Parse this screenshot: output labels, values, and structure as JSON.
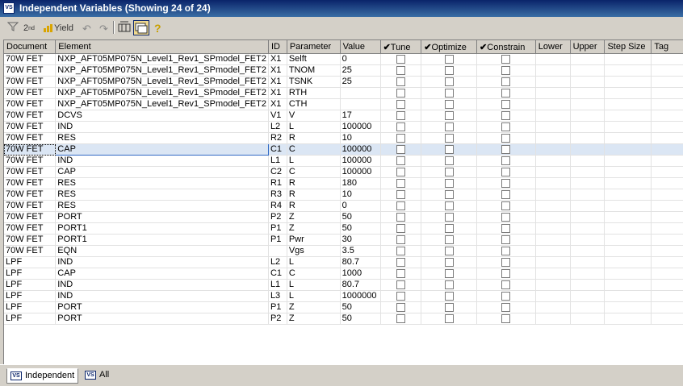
{
  "window": {
    "title": "Independent Variables (Showing 24 of 24)",
    "icon": "vs-icon"
  },
  "toolbar": {
    "filter_icon": "filter-icon",
    "sort_label": "2",
    "yield_label": "Yield",
    "undo_icon": "undo-icon",
    "redo_icon": "redo-icon",
    "columns_icon": "columns-icon",
    "view_icon": "view-icon",
    "help_icon": "help-icon"
  },
  "grid": {
    "columns": [
      "Document",
      "Element",
      "ID",
      "Parameter",
      "Value",
      "Tune",
      "Optimize",
      "Constrain",
      "Lower",
      "Upper",
      "Step Size",
      "Tag"
    ],
    "rows": [
      {
        "document": "70W FET",
        "element": "NXP_AFT05MP075N_Level1_Rev1_SPmodel_FET2",
        "id": "X1",
        "parameter": "Selft",
        "value": "0"
      },
      {
        "document": "70W FET",
        "element": "NXP_AFT05MP075N_Level1_Rev1_SPmodel_FET2",
        "id": "X1",
        "parameter": "TNOM",
        "value": "25"
      },
      {
        "document": "70W FET",
        "element": "NXP_AFT05MP075N_Level1_Rev1_SPmodel_FET2",
        "id": "X1",
        "parameter": "TSNK",
        "value": "25"
      },
      {
        "document": "70W FET",
        "element": "NXP_AFT05MP075N_Level1_Rev1_SPmodel_FET2",
        "id": "X1",
        "parameter": "RTH",
        "value": ""
      },
      {
        "document": "70W FET",
        "element": "NXP_AFT05MP075N_Level1_Rev1_SPmodel_FET2",
        "id": "X1",
        "parameter": "CTH",
        "value": ""
      },
      {
        "document": "70W FET",
        "element": "DCVS",
        "id": "V1",
        "parameter": "V",
        "value": "17"
      },
      {
        "document": "70W FET",
        "element": "IND",
        "id": "L2",
        "parameter": "L",
        "value": "100000"
      },
      {
        "document": "70W FET",
        "element": "RES",
        "id": "R2",
        "parameter": "R",
        "value": "10"
      },
      {
        "document": "70W FET",
        "element": "CAP",
        "id": "C1",
        "parameter": "C",
        "value": "100000"
      },
      {
        "document": "70W FET",
        "element": "IND",
        "id": "L1",
        "parameter": "L",
        "value": "100000"
      },
      {
        "document": "70W FET",
        "element": "CAP",
        "id": "C2",
        "parameter": "C",
        "value": "100000"
      },
      {
        "document": "70W FET",
        "element": "RES",
        "id": "R1",
        "parameter": "R",
        "value": "180"
      },
      {
        "document": "70W FET",
        "element": "RES",
        "id": "R3",
        "parameter": "R",
        "value": "10"
      },
      {
        "document": "70W FET",
        "element": "RES",
        "id": "R4",
        "parameter": "R",
        "value": "0"
      },
      {
        "document": "70W FET",
        "element": "PORT",
        "id": "P2",
        "parameter": "Z",
        "value": "50"
      },
      {
        "document": "70W FET",
        "element": "PORT1",
        "id": "P1",
        "parameter": "Z",
        "value": "50"
      },
      {
        "document": "70W FET",
        "element": "PORT1",
        "id": "P1",
        "parameter": "Pwr",
        "value": "30"
      },
      {
        "document": "70W FET",
        "element": "EQN",
        "id": "",
        "parameter": "Vgs",
        "value": "3.5"
      },
      {
        "document": "LPF",
        "element": "IND",
        "id": "L2",
        "parameter": "L",
        "value": "80.7"
      },
      {
        "document": "LPF",
        "element": "CAP",
        "id": "C1",
        "parameter": "C",
        "value": "1000"
      },
      {
        "document": "LPF",
        "element": "IND",
        "id": "L1",
        "parameter": "L",
        "value": "80.7"
      },
      {
        "document": "LPF",
        "element": "IND",
        "id": "L3",
        "parameter": "L",
        "value": "1000000"
      },
      {
        "document": "LPF",
        "element": "PORT",
        "id": "P1",
        "parameter": "Z",
        "value": "50"
      },
      {
        "document": "LPF",
        "element": "PORT",
        "id": "P2",
        "parameter": "Z",
        "value": "50"
      }
    ],
    "selected_row": 8
  },
  "tabs": {
    "independent": "Independent",
    "all": "All"
  }
}
